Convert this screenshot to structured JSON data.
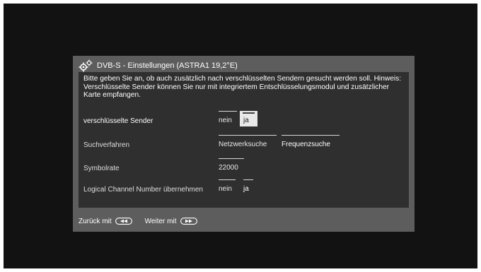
{
  "dialog": {
    "title": "DVB-S - Einstellungen (ASTRA1 19,2°E)",
    "title_icon": "gears-icon",
    "hint": "Bitte geben Sie an, ob auch zusätzlich nach verschlüsselten Sendern gesucht werden soll. Hinweis: Verschlüsselte Sender können Sie nur mit integriertem Entschlüsselungsmodul und zusätzlicher Karte empfangen."
  },
  "settings": [
    {
      "label": "verschlüsselte Sender",
      "options": [
        "nein",
        "ja"
      ],
      "selected": "ja",
      "focused": true
    },
    {
      "label": "Suchverfahren",
      "options": [
        "Netzwerksuche",
        "Frequenzsuche"
      ],
      "selected": "Frequenzsuche",
      "focused": false
    },
    {
      "label": "Symbolrate",
      "value": "22000",
      "focused": false
    },
    {
      "label": "Logical Channel Number übernehmen",
      "options": [
        "nein",
        "ja"
      ],
      "selected": "ja",
      "focused": false
    }
  ],
  "footer": {
    "back_label": "Zurück mit",
    "back_icon": "rewind-button-icon",
    "next_label": "Weiter mit",
    "next_icon": "fast-forward-button-icon"
  },
  "colors": {
    "screen_bg": "#121212",
    "dialog_bg": "#5d5d5d",
    "panel_bg": "#2f2f2f",
    "focus_bg": "#e9e9e9"
  }
}
